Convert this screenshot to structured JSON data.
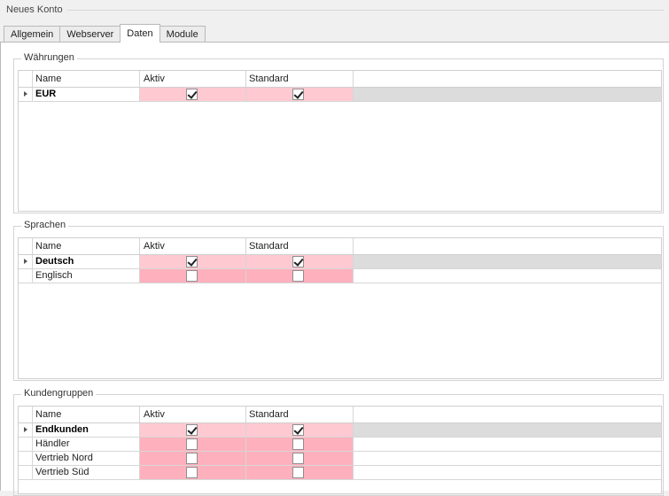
{
  "window": {
    "title": "Neues Konto"
  },
  "tabs": [
    {
      "label": "Allgemein",
      "active": false
    },
    {
      "label": "Webserver",
      "active": false
    },
    {
      "label": "Daten",
      "active": true
    },
    {
      "label": "Module",
      "active": false
    }
  ],
  "groups": {
    "waehrungen": {
      "legend": "Währungen",
      "columns": {
        "name": "Name",
        "aktiv": "Aktiv",
        "standard": "Standard"
      },
      "rows": [
        {
          "name": "EUR",
          "aktiv": true,
          "standard": true
        }
      ]
    },
    "sprachen": {
      "legend": "Sprachen",
      "columns": {
        "name": "Name",
        "aktiv": "Aktiv",
        "standard": "Standard"
      },
      "rows": [
        {
          "name": "Deutsch",
          "aktiv": true,
          "standard": true
        },
        {
          "name": "Englisch",
          "aktiv": false,
          "standard": false
        }
      ]
    },
    "kundengruppen": {
      "legend": "Kundengruppen",
      "columns": {
        "name": "Name",
        "aktiv": "Aktiv",
        "standard": "Standard"
      },
      "rows": [
        {
          "name": "Endkunden",
          "aktiv": true,
          "standard": true
        },
        {
          "name": "Händler",
          "aktiv": false,
          "standard": false
        },
        {
          "name": "Vertrieb Nord",
          "aktiv": false,
          "standard": false
        },
        {
          "name": "Vertrieb Süd",
          "aktiv": false,
          "standard": false
        }
      ]
    }
  },
  "colors": {
    "current_row_cell": "#ffc9d2",
    "other_row_cell": "#ffb0bd",
    "current_row_fill": "#dcdcdc"
  }
}
